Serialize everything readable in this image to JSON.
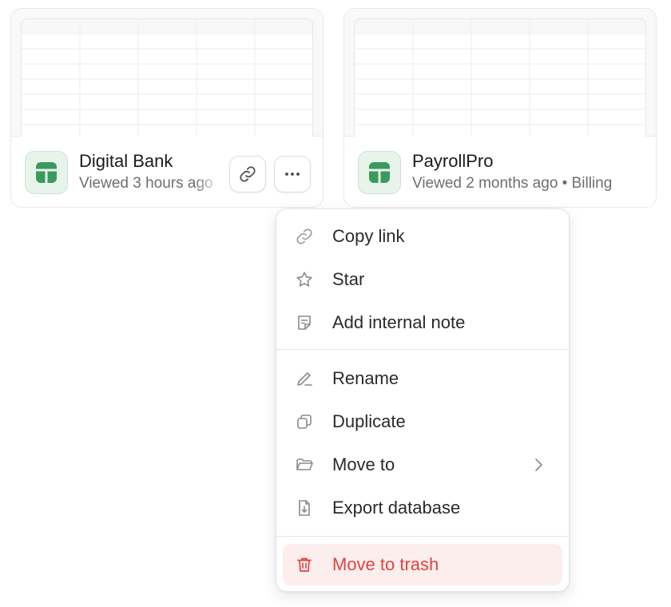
{
  "cards": [
    {
      "title": "Digital Bank",
      "subtitle": "Viewed 3 hours ago",
      "icon": "spreadsheet-icon"
    },
    {
      "title": "PayrollPro",
      "subtitle": "Viewed 2 months ago • Billing",
      "icon": "spreadsheet-icon"
    }
  ],
  "card_actions": {
    "link_icon": "link-icon",
    "more_icon": "more-horizontal-icon"
  },
  "menu": {
    "groups": [
      [
        {
          "label": "Copy link",
          "icon": "link-icon"
        },
        {
          "label": "Star",
          "icon": "star-icon"
        },
        {
          "label": "Add internal note",
          "icon": "note-icon"
        }
      ],
      [
        {
          "label": "Rename",
          "icon": "pencil-icon"
        },
        {
          "label": "Duplicate",
          "icon": "duplicate-icon"
        },
        {
          "label": "Move to",
          "icon": "folder-icon",
          "submenu": true
        },
        {
          "label": "Export database",
          "icon": "export-file-icon"
        }
      ],
      [
        {
          "label": "Move to trash",
          "icon": "trash-icon",
          "danger": true
        }
      ]
    ]
  },
  "colors": {
    "accent_green": "#3a9a5c",
    "danger_red": "#e0433e",
    "danger_bg": "#fdeeee"
  }
}
